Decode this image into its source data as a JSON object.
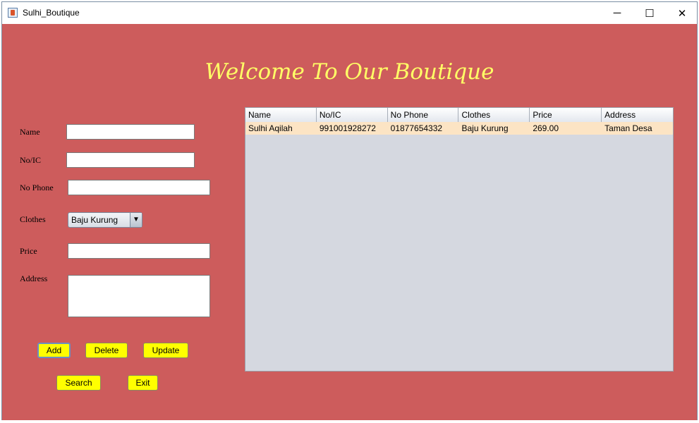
{
  "window": {
    "title": "Sulhi_Boutique",
    "minimize_glyph": "─",
    "maximize_glyph": "☐",
    "close_glyph": "✕"
  },
  "heading": "Welcome To Our Boutique",
  "form": {
    "name_label": "Name",
    "ic_label": "No/IC",
    "phone_label": "No Phone",
    "clothes_label": "Clothes",
    "price_label": "Price",
    "address_label": "Address",
    "name_value": "",
    "ic_value": "",
    "phone_value": "",
    "clothes_selected": "Baju Kurung",
    "price_value": "",
    "address_value": ""
  },
  "buttons": {
    "add": "Add",
    "delete": "Delete",
    "update": "Update",
    "search": "Search",
    "exit": "Exit"
  },
  "table": {
    "columns": [
      "Name",
      "No/IC",
      "No Phone",
      "Clothes",
      "Price",
      "Address"
    ],
    "rows": [
      [
        "Sulhi Aqilah",
        "991001928272",
        "01877654332",
        "Baju Kurung",
        "269.00",
        "Taman Desa"
      ]
    ]
  },
  "colors": {
    "background": "#cd5c5c",
    "heading": "#ffff66",
    "button": "#ffff00",
    "selected_row": "#fce4c4",
    "table_bg": "#d5d8e0"
  }
}
